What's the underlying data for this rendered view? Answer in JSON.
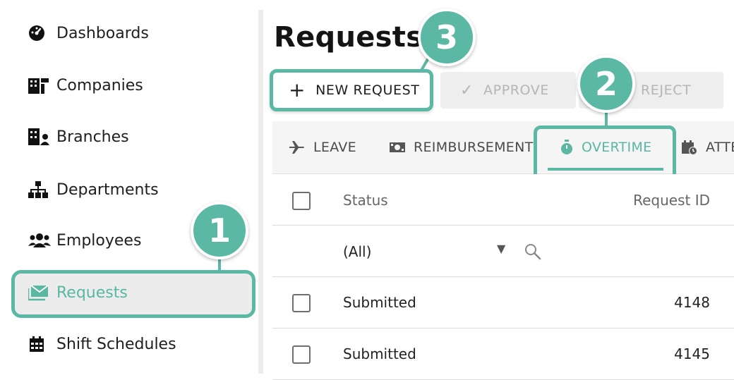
{
  "sidebar": {
    "items": [
      {
        "label": "Dashboards",
        "icon": "dashboard-icon"
      },
      {
        "label": "Companies",
        "icon": "companies-icon"
      },
      {
        "label": "Branches",
        "icon": "branches-icon"
      },
      {
        "label": "Departments",
        "icon": "departments-icon"
      },
      {
        "label": "Employees",
        "icon": "employees-icon"
      },
      {
        "label": "Requests",
        "icon": "envelope-icon",
        "active": true
      },
      {
        "label": "Shift Schedules",
        "icon": "calendar-icon"
      }
    ]
  },
  "page": {
    "title": "Requests"
  },
  "toolbar": {
    "new_label": "NEW REQUEST",
    "approve_label": "APPROVE",
    "reject_label": "REJECT"
  },
  "tabs": [
    {
      "label": "LEAVE",
      "icon": "plane-icon"
    },
    {
      "label": "REIMBURSEMENT",
      "icon": "money-icon"
    },
    {
      "label": "OVERTIME",
      "icon": "stopwatch-icon",
      "active": true
    },
    {
      "label": "ATTE",
      "icon": "calendar-clock-icon"
    }
  ],
  "table": {
    "columns": [
      "Status",
      "Request ID"
    ],
    "filter": {
      "status_value": "(All)"
    },
    "rows": [
      {
        "status": "Submitted",
        "request_id": "4148"
      },
      {
        "status": "Submitted",
        "request_id": "4145"
      }
    ]
  },
  "callouts": {
    "one": "1",
    "two": "2",
    "three": "3"
  },
  "colors": {
    "accent": "#5ab8a4",
    "text": "#1e1e1e",
    "disabled": "#b5b5b5"
  }
}
